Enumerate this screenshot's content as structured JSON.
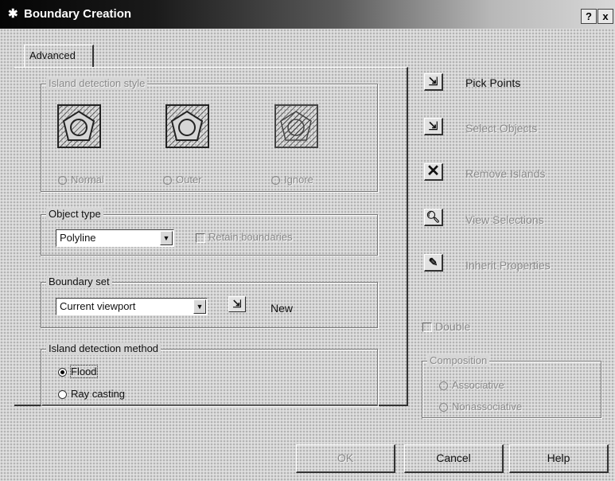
{
  "window": {
    "title": "Boundary Creation",
    "title_icon": "hatch-icon",
    "help_button": "?",
    "close_button": "x"
  },
  "tabs": [
    {
      "label": "Advanced",
      "selected": true
    }
  ],
  "island_detection_style": {
    "title": "Island detection style",
    "options": [
      {
        "label": "Normal",
        "selected": false
      },
      {
        "label": "Outer",
        "selected": false
      },
      {
        "label": "Ignore",
        "selected": false
      }
    ]
  },
  "object_type": {
    "title": "Object type",
    "value": "Polyline",
    "retain_boundaries_label": "Retain boundaries",
    "retain_boundaries_checked": false
  },
  "boundary_set": {
    "title": "Boundary set",
    "value": "Current viewport",
    "new_label": "New"
  },
  "island_detection_method": {
    "title": "Island detection method",
    "options": [
      {
        "label": "Flood",
        "selected": true
      },
      {
        "label": "Ray casting",
        "selected": false
      }
    ]
  },
  "side_actions": [
    {
      "label": "Pick Points",
      "icon": "pick-points-icon",
      "enabled": true
    },
    {
      "label": "Select Objects",
      "icon": "select-objects-icon",
      "enabled": false
    },
    {
      "label": "Remove Islands",
      "icon": "remove-islands-icon",
      "enabled": false
    },
    {
      "label": "View Selections",
      "icon": "view-selections-icon",
      "enabled": false
    },
    {
      "label": "Inherit Properties",
      "icon": "inherit-properties-icon",
      "enabled": false
    }
  ],
  "double": {
    "label": "Double",
    "checked": false
  },
  "composition": {
    "title": "Composition",
    "options": [
      {
        "label": "Associative",
        "selected": false
      },
      {
        "label": "Nonassociative",
        "selected": false
      }
    ]
  },
  "buttons": {
    "ok": "OK",
    "cancel": "Cancel",
    "help": "Help"
  }
}
